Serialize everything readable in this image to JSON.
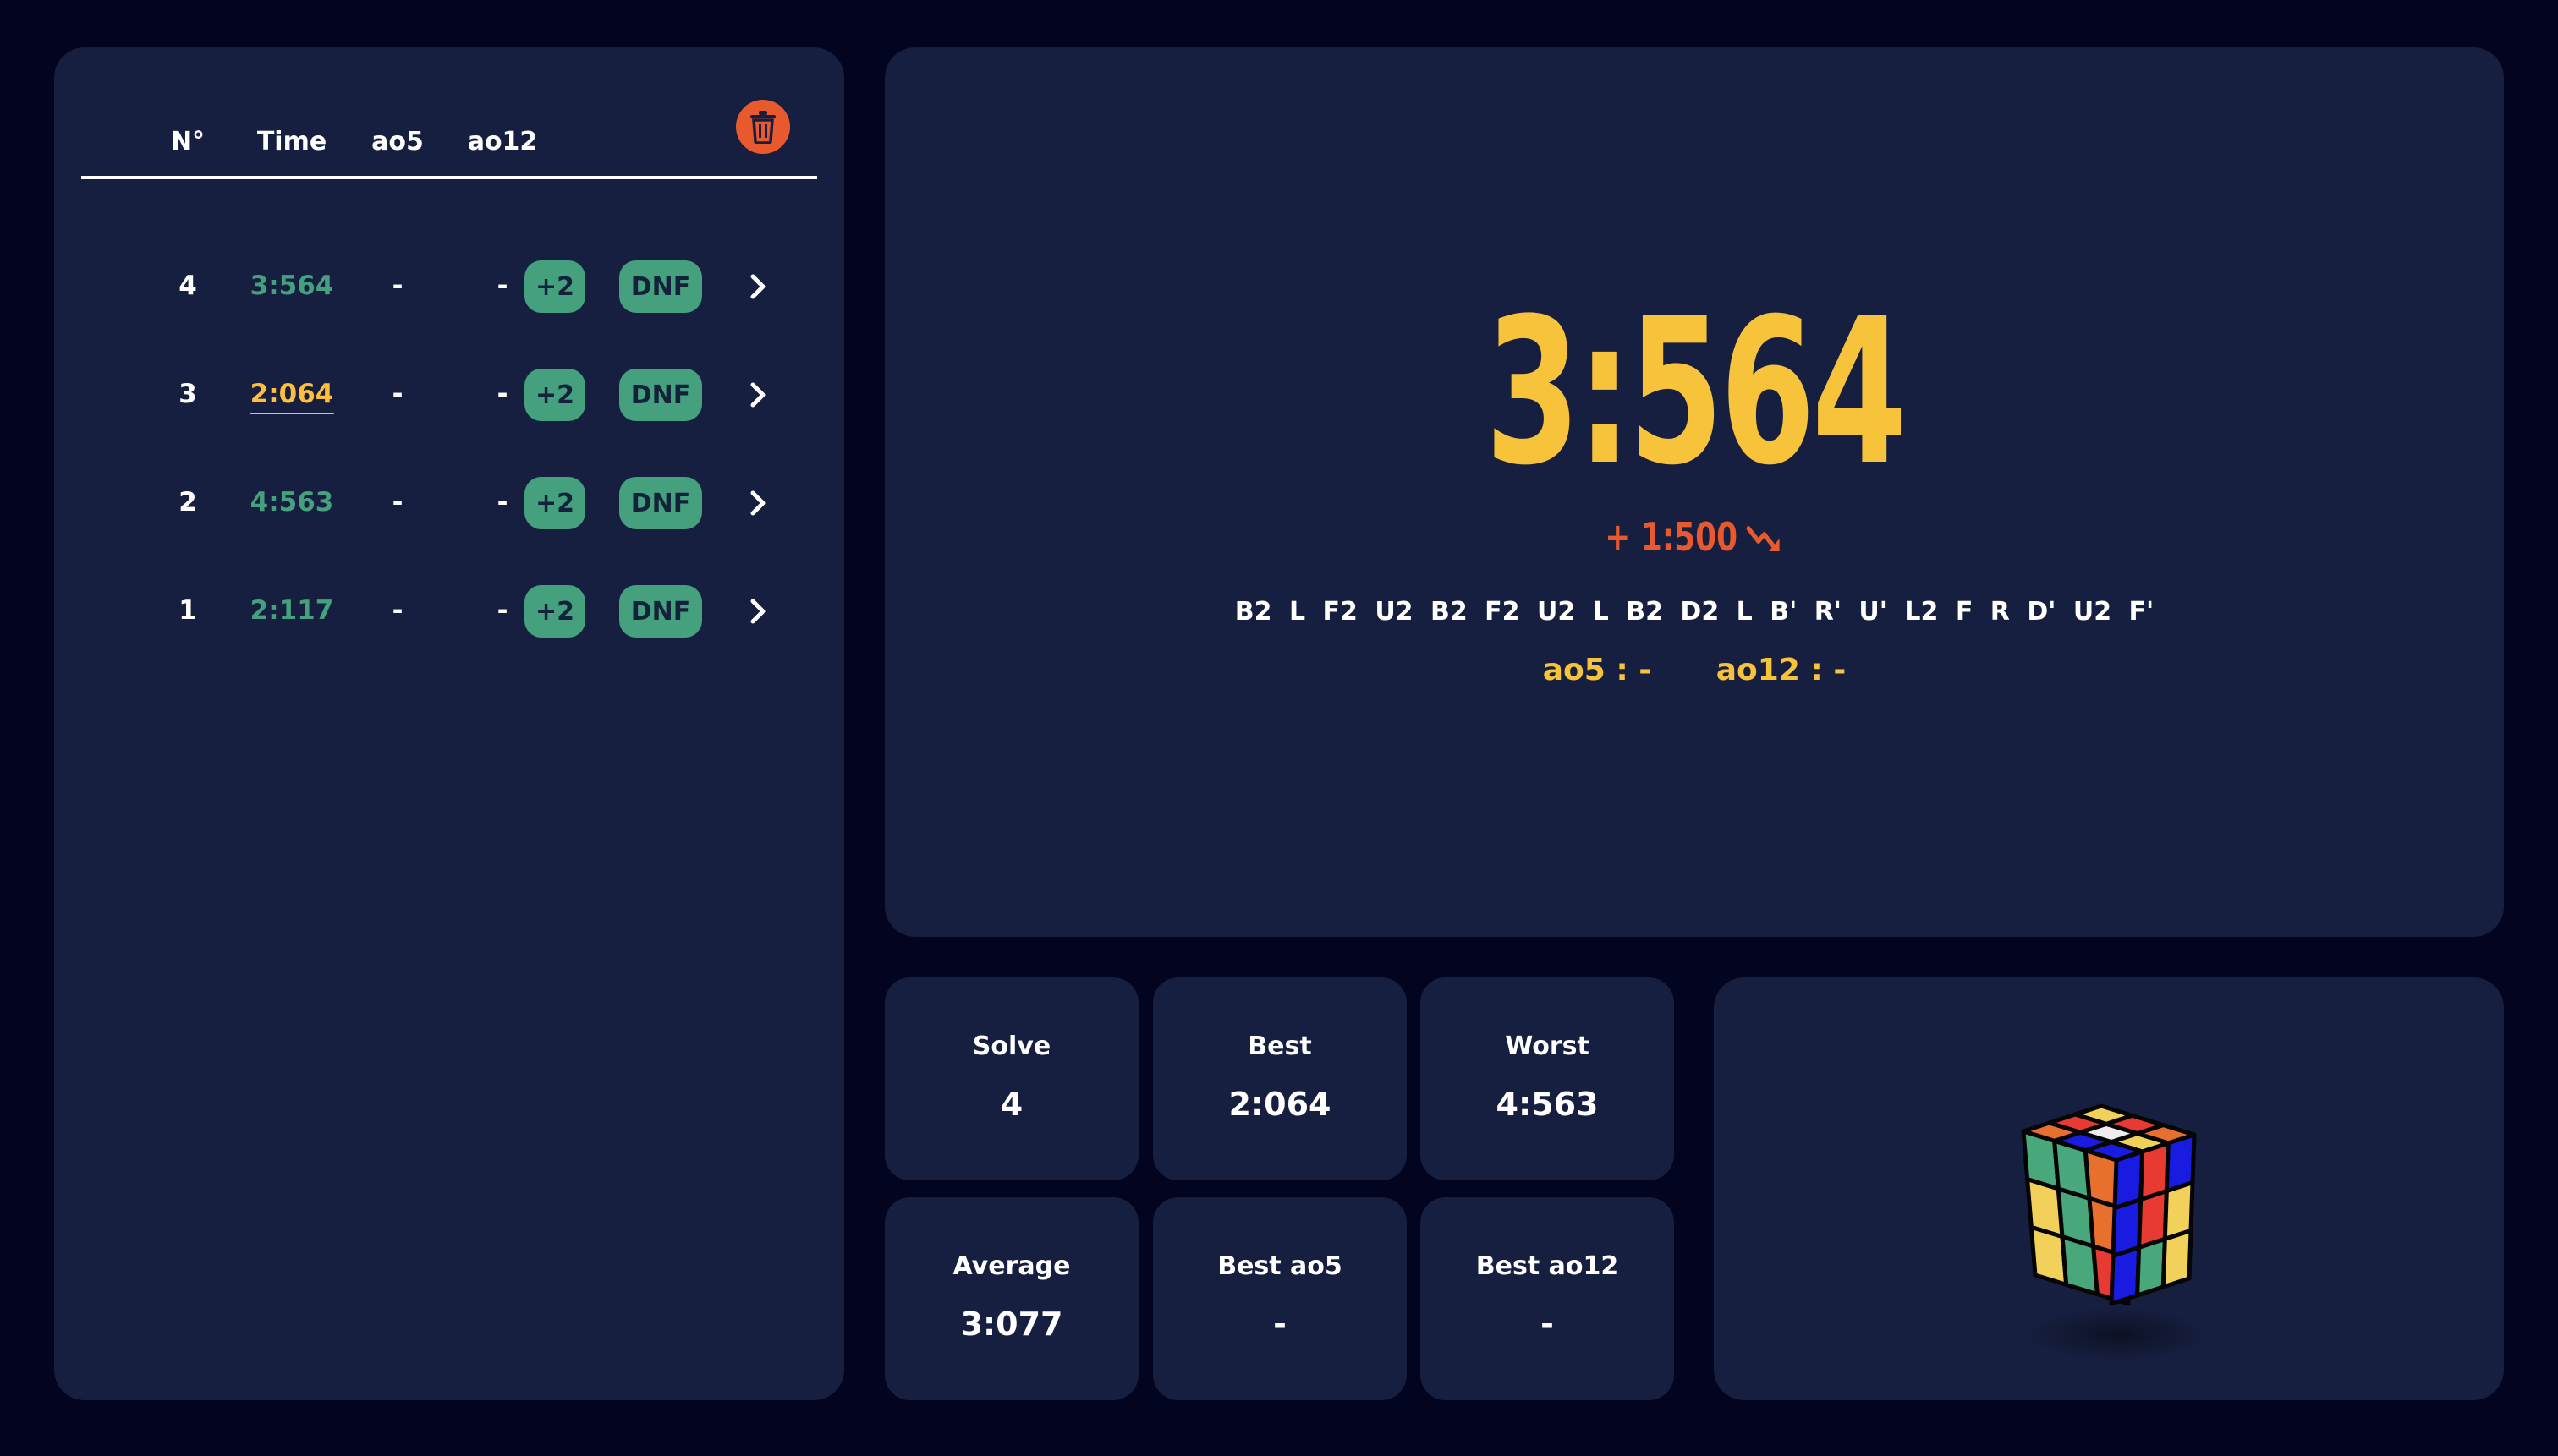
{
  "history": {
    "headers": {
      "number": "N°",
      "time": "Time",
      "ao5": "ao5",
      "ao12": "ao12"
    },
    "rows": [
      {
        "number": "4",
        "time": "3:564",
        "ao5": "-",
        "ao12": "-",
        "plus2": "+2",
        "dnf": "DNF"
      },
      {
        "number": "3",
        "time": "2:064",
        "ao5": "-",
        "ao12": "-",
        "plus2": "+2",
        "dnf": "DNF"
      },
      {
        "number": "2",
        "time": "4:563",
        "ao5": "-",
        "ao12": "-",
        "plus2": "+2",
        "dnf": "DNF"
      },
      {
        "number": "1",
        "time": "2:117",
        "ao5": "-",
        "ao12": "-",
        "plus2": "+2",
        "dnf": "DNF"
      }
    ],
    "highlighted_row_number": "3",
    "icons": {
      "clear": "trash-icon",
      "open_row": "chevron-right-icon"
    }
  },
  "timer": {
    "time": "3:564",
    "delta": "+ 1:500",
    "delta_icon": "trend-down-icon",
    "scramble": "B2 L F2 U2 B2 F2 U2 L B2 D2 L B' R' U' L2 F R D' U2 F'",
    "ao5": "ao5 : -",
    "ao12": "ao12 : -"
  },
  "stats": {
    "solve": {
      "label": "Solve",
      "value": "4"
    },
    "best": {
      "label": "Best",
      "value": "2:064"
    },
    "worst": {
      "label": "Worst",
      "value": "4:563"
    },
    "average": {
      "label": "Average",
      "value": "3:077"
    },
    "best_ao5": {
      "label": "Best ao5",
      "value": "-"
    },
    "best_ao12": {
      "label": "Best ao12",
      "value": "-"
    }
  },
  "cube_preview": {
    "icon": "rubiks-cube-icon"
  },
  "colors": {
    "background": "#03041f",
    "panel": "#161f40",
    "green": "#45a07d",
    "yellow": "#f7c33b",
    "orange": "#e85a2e",
    "text": "#ffffff"
  }
}
